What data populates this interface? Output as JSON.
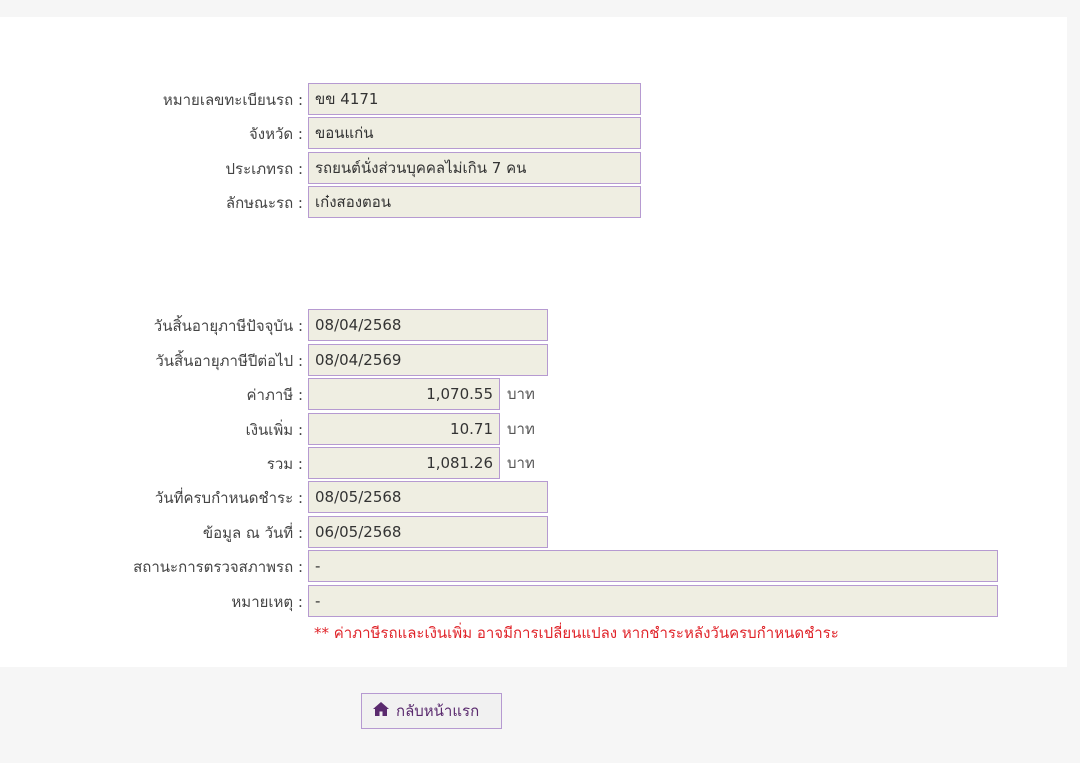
{
  "vehicle": {
    "plate_label": "หมายเลขทะเบียนรถ :",
    "plate_value": "ขข 4171",
    "province_label": "จังหวัด :",
    "province_value": "ขอนแก่น",
    "type_label": "ประเภทรถ :",
    "type_value": "รถยนต์นั่งส่วนบุคคลไม่เกิน 7 คน",
    "style_label": "ลักษณะรถ :",
    "style_value": "เก๋งสองตอน"
  },
  "tax": {
    "current_expiry_label": "วันสิ้นอายุภาษีปัจจุบัน :",
    "current_expiry_value": "08/04/2568",
    "next_expiry_label": "วันสิ้นอายุภาษีปีต่อไป :",
    "next_expiry_value": "08/04/2569",
    "tax_label": "ค่าภาษี :",
    "tax_value": "1,070.55",
    "surcharge_label": "เงินเพิ่ม :",
    "surcharge_value": "10.71",
    "total_label": "รวม :",
    "total_value": "1,081.26",
    "unit": "บาท",
    "due_label": "วันที่ครบกำหนดชำระ :",
    "due_value": "08/05/2568",
    "data_date_label": "ข้อมูล ณ วันที่ :",
    "data_date_value": "06/05/2568",
    "inspection_label": "สถานะการตรวจสภาพรถ :",
    "inspection_value": "-",
    "remark_label": "หมายเหตุ :",
    "remark_value": "-",
    "note": "** ค่าภาษีรถและเงินเพิ่ม อาจมีการเปลี่ยนแปลง หากชำระหลังวันครบกำหนดชำระ"
  },
  "nav": {
    "home_label": "กลับหน้าแรก",
    "home_icon": "home-icon"
  },
  "colors": {
    "field_bg": "#efeee2",
    "field_border": "#b69ad1",
    "note": "#e0242a",
    "button_text": "#5a2a6e"
  }
}
